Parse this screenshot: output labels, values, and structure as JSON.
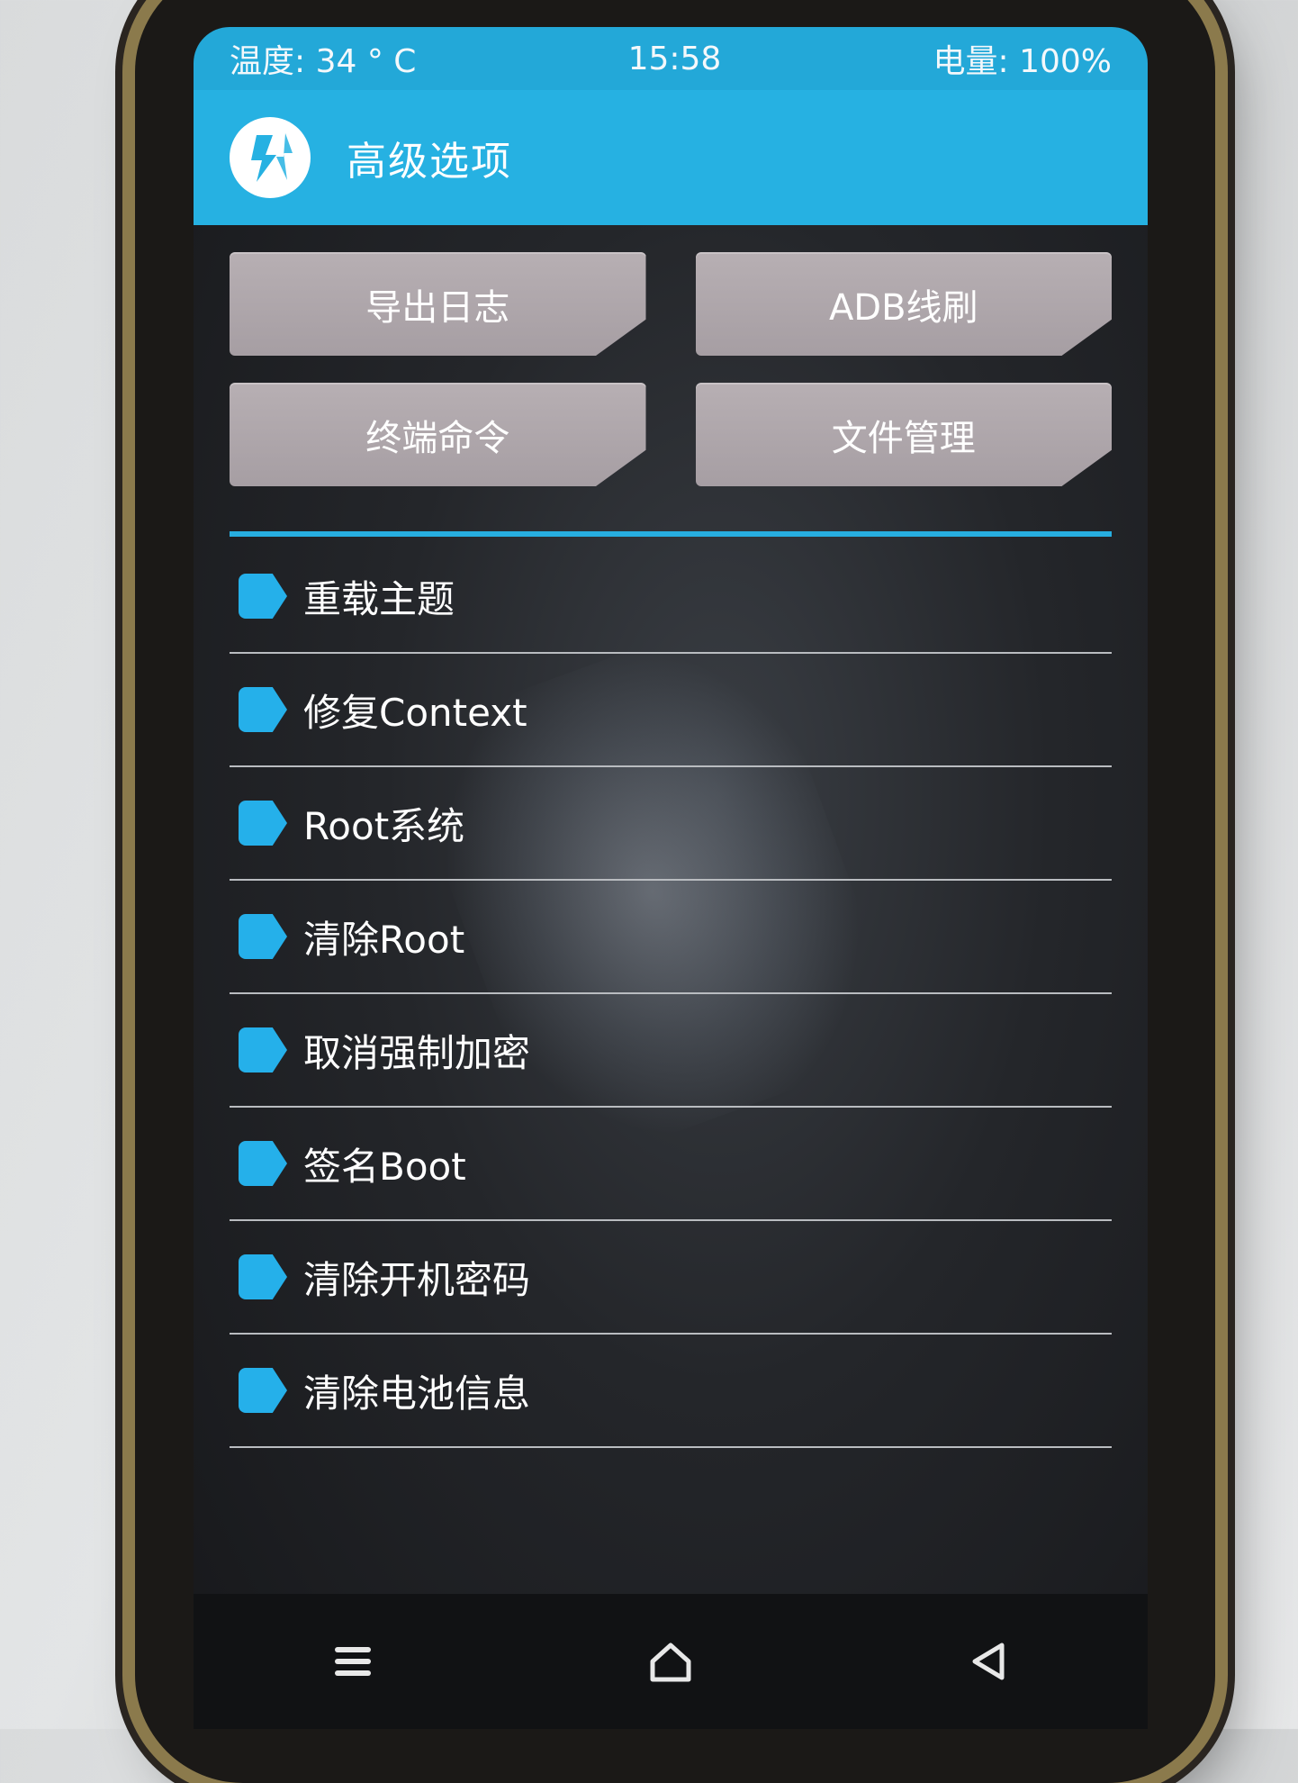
{
  "status_bar": {
    "temperature": "温度: 34 ° C",
    "time": "15:58",
    "battery": "电量: 100%"
  },
  "header": {
    "title": "高级选项",
    "logo_icon": "twrp-logo-icon"
  },
  "buttons": [
    {
      "label": "导出日志"
    },
    {
      "label": "ADB线刷"
    },
    {
      "label": "终端命令"
    },
    {
      "label": "文件管理"
    }
  ],
  "list_items": [
    {
      "label": "重载主题"
    },
    {
      "label": "修复Context"
    },
    {
      "label": "Root系统"
    },
    {
      "label": "清除Root"
    },
    {
      "label": "取消强制加密"
    },
    {
      "label": "签名Boot"
    },
    {
      "label": "清除开机密码"
    },
    {
      "label": "清除电池信息"
    }
  ],
  "navbar": {
    "menu_icon": "menu-icon",
    "home_icon": "home-icon",
    "back_icon": "back-icon"
  },
  "colors": {
    "accent": "#26b1e2",
    "button": "#aca4a8",
    "bullet": "#25b0ea"
  }
}
